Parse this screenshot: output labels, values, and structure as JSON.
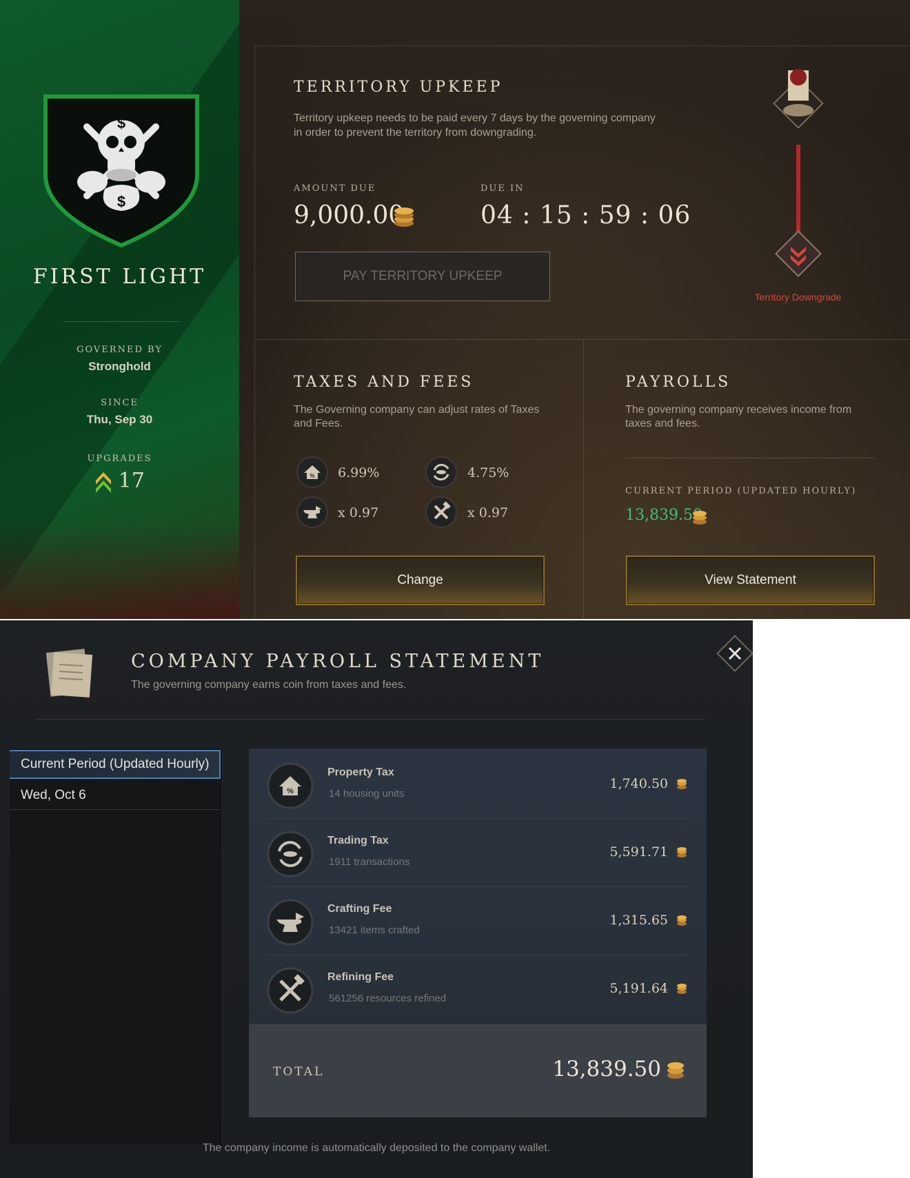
{
  "territory": {
    "name": "FIRST LIGHT",
    "governed_by_label": "GOVERNED BY",
    "governed_by": "Stronghold",
    "since_label": "SINCE",
    "since": "Thu, Sep 30",
    "upgrades_label": "UPGRADES",
    "upgrades": "17"
  },
  "upkeep": {
    "title": "TERRITORY UPKEEP",
    "description": "Territory upkeep needs to be paid every 7 days by the governing company in order to prevent the territory from downgrading.",
    "amount_due_label": "AMOUNT DUE",
    "amount_due": "9,000.00",
    "due_in_label": "DUE IN",
    "due_in": "04 : 15 : 59 : 06",
    "pay_button": "PAY TERRITORY UPKEEP",
    "downgrade_label": "Territory Downgrade"
  },
  "taxes": {
    "title": "TAXES AND FEES",
    "description": "The Governing company can adjust rates of Taxes and Fees.",
    "property_tax": "6.99%",
    "trading_tax": "4.75%",
    "crafting_fee": "x 0.97",
    "refining_fee": "x 0.97",
    "change_button": "Change"
  },
  "payrolls": {
    "title": "PAYROLLS",
    "description": "The governing company receives income from taxes and fees.",
    "current_period_label": "CURRENT PERIOD (UPDATED HOURLY)",
    "current_period_value": "13,839.50",
    "view_statement_button": "View Statement"
  },
  "statement": {
    "title": "COMPANY PAYROLL STATEMENT",
    "subtitle": "The governing company earns coin from taxes and fees.",
    "periods": [
      "Current Period (Updated Hourly)",
      "Wed, Oct 6"
    ],
    "rows": [
      {
        "name": "Property Tax",
        "sub": "14 housing units",
        "amount": "1,740.50"
      },
      {
        "name": "Trading Tax",
        "sub": "1911 transactions",
        "amount": "5,591.71"
      },
      {
        "name": "Crafting Fee",
        "sub": "13421 items crafted",
        "amount": "1,315.65"
      },
      {
        "name": "Refining Fee",
        "sub": "561256 resources refined",
        "amount": "5,191.64"
      }
    ],
    "total_label": "TOTAL",
    "total": "13,839.50",
    "footer": "The company income is automatically deposited to the company wallet."
  },
  "icons": [
    "skull-crest-icon",
    "chevron-rank-icon",
    "coin-stack-icon",
    "house-percent-icon",
    "trade-cycle-icon",
    "anvil-icon",
    "hammer-pick-icon",
    "scroll-icon",
    "close-icon",
    "downgrade-chevron-icon"
  ],
  "colors": {
    "banner_green": "#0b4a23",
    "income_green": "#3dbf86",
    "downgrade_red": "#d2453d",
    "gold_border": "#8a6d2c",
    "selected_blue": "#4f7fb0"
  }
}
